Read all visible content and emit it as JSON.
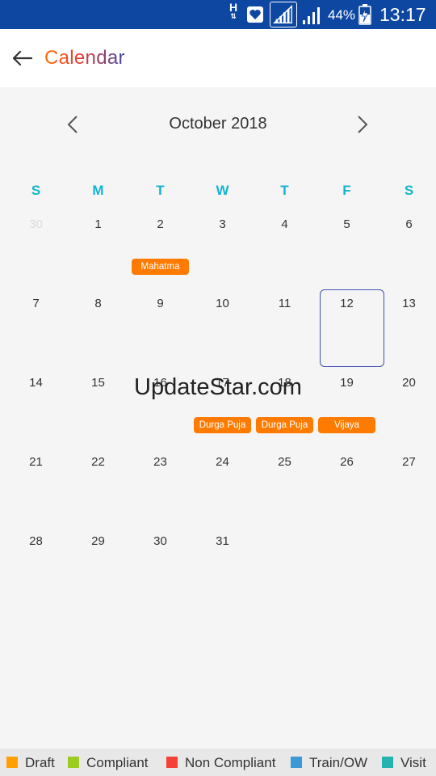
{
  "status_bar": {
    "network": "H",
    "battery_percent": "44%",
    "time": "13:17"
  },
  "app_bar": {
    "title": "Calendar",
    "back_icon": "arrow-left-icon"
  },
  "calendar": {
    "month_label": "October 2018",
    "weekdays": [
      "S",
      "M",
      "T",
      "W",
      "T",
      "F",
      "S"
    ],
    "weeks": [
      [
        "30",
        "1",
        "2",
        "3",
        "4",
        "5",
        "6"
      ],
      [
        "7",
        "8",
        "9",
        "10",
        "11",
        "12",
        "13"
      ],
      [
        "14",
        "15",
        "16",
        "17",
        "18",
        "19",
        "20"
      ],
      [
        "21",
        "22",
        "23",
        "24",
        "25",
        "26",
        "27"
      ],
      [
        "28",
        "29",
        "30",
        "31",
        "",
        "",
        ""
      ]
    ],
    "selected_day": "12",
    "events": [
      {
        "week": 0,
        "col": 2,
        "label": "Mahatma"
      },
      {
        "week": 2,
        "col": 3,
        "label": "Durga Puja"
      },
      {
        "week": 2,
        "col": 4,
        "label": "Durga Puja"
      },
      {
        "week": 2,
        "col": 5,
        "label": "Vijaya"
      }
    ],
    "event_color": "#ff7b00",
    "weekday_color": "#12b5d0"
  },
  "watermark": "UpdateStar.com",
  "legend": [
    {
      "label": "Draft",
      "color": "#ffa000"
    },
    {
      "label": "Compliant",
      "color": "#9ccc22"
    },
    {
      "label": "Non Compliant",
      "color": "#f44336"
    },
    {
      "label": "Train/OW",
      "color": "#3d98d8"
    },
    {
      "label": "Visit",
      "color": "#26b3b0"
    }
  ]
}
